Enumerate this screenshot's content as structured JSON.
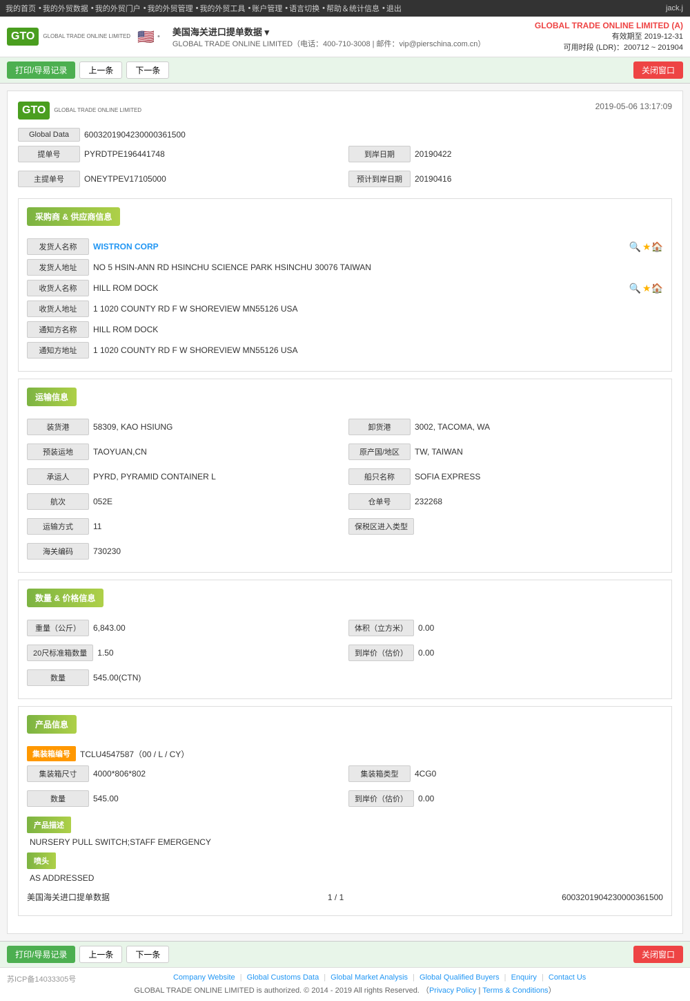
{
  "topnav": {
    "items": [
      "我的首页",
      "我的外贸数据",
      "我的外贸门户",
      "我的外贸管理",
      "我的外贸工具",
      "账户管理",
      "语言切换",
      "帮助＆统计信息",
      "退出"
    ],
    "user": "jack.j"
  },
  "header": {
    "logo_text": "GTO",
    "logo_sub": "GLOBAL TRADE\nONLINE LIMITED",
    "country_flag": "🇺🇸",
    "title": "美国海关进口提单数据 ▾",
    "subtitle": "GLOBAL TRADE ONLINE LIMITED（电话：400-710-3008 | 邮件：vip@pierschina.com.cn）",
    "company": "GLOBAL TRADE ONLINE LIMITED (A)",
    "validity_label": "有效期至",
    "validity_date": "2019-12-31",
    "ldr_label": "可用时段 (LDR)：200712 ~ 201904"
  },
  "toolbar": {
    "print_btn": "打印/导易记录",
    "prev_btn": "上一条",
    "next_btn": "下一条",
    "close_btn": "关闭窗口"
  },
  "record": {
    "timestamp": "2019-05-06 13:17:09",
    "global_data_label": "Global Data",
    "global_data_value": "6003201904230000361500",
    "bill_no_label": "提单号",
    "bill_no_value": "PYRDTPE196441748",
    "arrival_date_label": "到岸日期",
    "arrival_date_value": "20190422",
    "master_bill_label": "主提单号",
    "master_bill_value": "ONEYTPEV17105000",
    "est_arrival_label": "预计到岸日期",
    "est_arrival_value": "20190416"
  },
  "supplier_section": {
    "title": "采购商 & 供应商信息",
    "shipper_name_label": "发货人名称",
    "shipper_name_value": "WISTRON CORP",
    "shipper_addr_label": "发货人地址",
    "shipper_addr_value": "NO 5 HSIN-ANN RD HSINCHU SCIENCE PARK HSINCHU 30076 TAIWAN",
    "consignee_name_label": "收货人名称",
    "consignee_name_value": "HILL ROM DOCK",
    "consignee_addr_label": "收货人地址",
    "consignee_addr_value": "1 1020 COUNTY RD F W SHOREVIEW MN55126 USA",
    "notify_name_label": "通知方名称",
    "notify_name_value": "HILL ROM DOCK",
    "notify_addr_label": "通知方地址",
    "notify_addr_value": "1 1020 COUNTY RD F W SHOREVIEW MN55126 USA"
  },
  "shipping_section": {
    "title": "运输信息",
    "loading_port_label": "装货港",
    "loading_port_value": "58309, KAO HSIUNG",
    "discharge_port_label": "卸货港",
    "discharge_port_value": "3002, TACOMA, WA",
    "transit_label": "预装运地",
    "transit_value": "TAOYUAN,CN",
    "origin_label": "原产国/地区",
    "origin_value": "TW, TAIWAN",
    "carrier_label": "承运人",
    "carrier_value": "PYRD, PYRAMID CONTAINER L",
    "vessel_label": "船只名称",
    "vessel_value": "SOFIA EXPRESS",
    "voyage_label": "航次",
    "voyage_value": "052E",
    "bill_lading_label": "仓单号",
    "bill_lading_value": "232268",
    "transport_label": "运输方式",
    "transport_value": "11",
    "customs_label": "保税区进入类型",
    "customs_value": "",
    "customs_code_label": "海关编码",
    "customs_code_value": "730230"
  },
  "quantity_section": {
    "title": "数量 & 价格信息",
    "weight_label": "重量（公斤）",
    "weight_value": "6,843.00",
    "volume_label": "体积（立方米）",
    "volume_value": "0.00",
    "teu_label": "20尺标准箱数量",
    "teu_value": "1.50",
    "arrival_price_label": "到岸价（估价）",
    "arrival_price_value": "0.00",
    "quantity_label": "数量",
    "quantity_value": "545.00(CTN)"
  },
  "product_section": {
    "title": "产品信息",
    "container_no_label": "集装箱编号",
    "container_no_value": "TCLU4547587（00 / L / CY）",
    "container_size_label": "集装箱尺寸",
    "container_size_value": "4000*806*802",
    "container_type_label": "集装箱类型",
    "container_type_value": "4CG0",
    "quantity_label": "数量",
    "quantity_value": "545.00",
    "price_label": "到岸价（估价）",
    "price_value": "0.00",
    "desc_title": "产品描述",
    "desc_text": "NURSERY PULL SWITCH;STAFF EMERGENCY",
    "port_title": "喷头",
    "port_text": "AS ADDRESSED"
  },
  "pagination": {
    "title": "美国海关进口提单数据",
    "page": "1 / 1",
    "record_id": "6003201904230000361500"
  },
  "footer_links": {
    "company_website": "Company Website",
    "global_customs": "Global Customs Data",
    "global_market": "Global Market Analysis",
    "global_buyers": "Global Qualified Buyers",
    "enquiry": "Enquiry",
    "contact": "Contact Us",
    "copyright": "GLOBAL TRADE ONLINE LIMITED is authorized. © 2014 - 2019 All rights Reserved.",
    "privacy": "Privacy Policy",
    "terms": "Terms & Conditions",
    "icp": "苏ICP备14033305号"
  }
}
